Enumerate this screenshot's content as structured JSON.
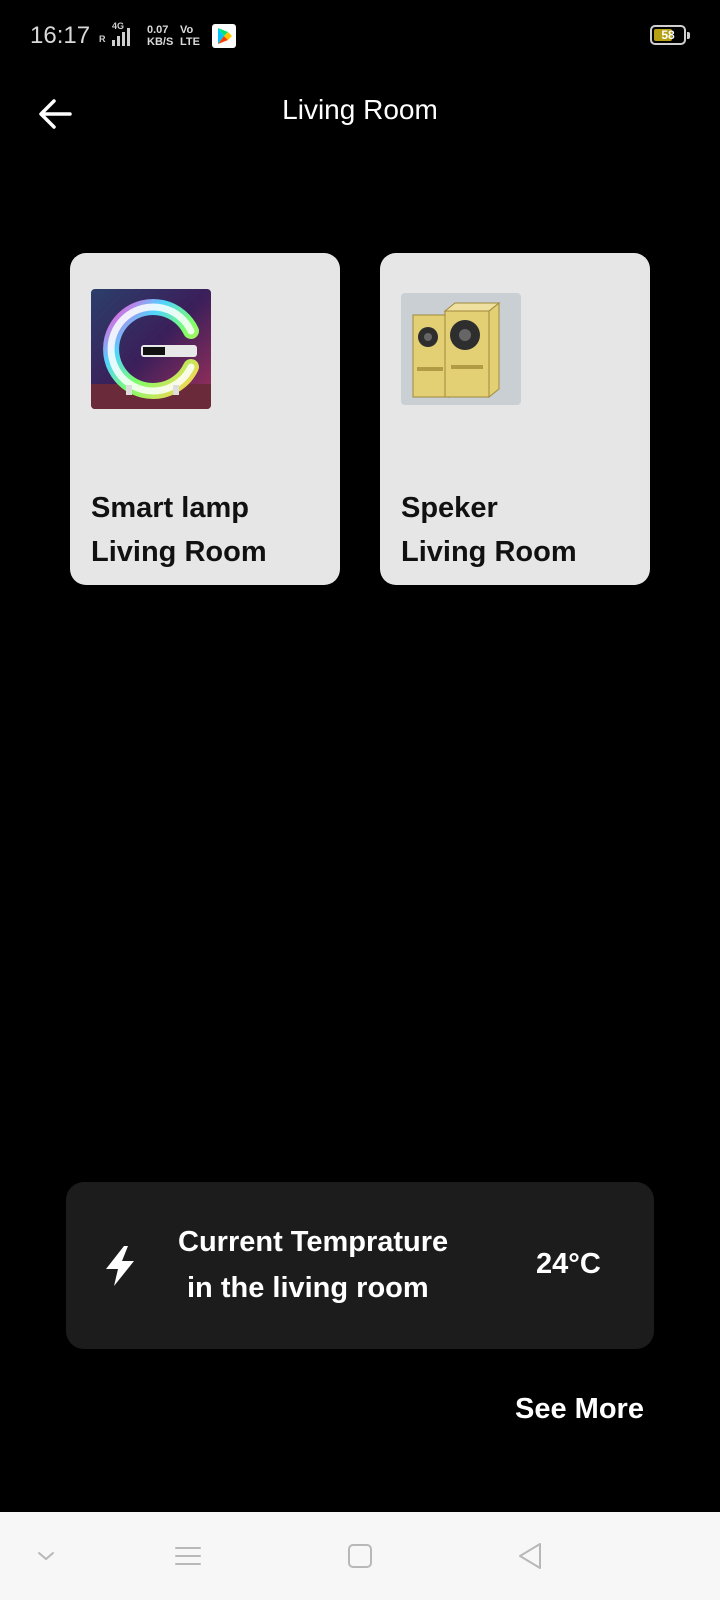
{
  "status_bar": {
    "time": "16:17",
    "network_top": "4G",
    "network_left": "R",
    "speed_value": "0.07",
    "speed_unit": "KB/S",
    "volte_top": "Vo",
    "volte_bottom": "LTE",
    "battery_level": "58",
    "icons": [
      "signal-icon",
      "play-store-icon",
      "battery-icon"
    ]
  },
  "header": {
    "title": "Living Room",
    "back_icon": "arrow-left-icon"
  },
  "devices": [
    {
      "name": "Smart lamp",
      "room": "Living Room",
      "image": "smart-lamp-image"
    },
    {
      "name": "Speker",
      "room": "Living Room",
      "image": "speaker-image"
    }
  ],
  "temperature": {
    "line1": "Current Temprature",
    "line2": "in the living room",
    "value": "24°C",
    "icon": "lightning-icon"
  },
  "see_more": "See More",
  "nav_bar": {
    "icons": [
      "chevron-down-icon",
      "menu-icon",
      "home-square-icon",
      "back-triangle-icon"
    ]
  }
}
